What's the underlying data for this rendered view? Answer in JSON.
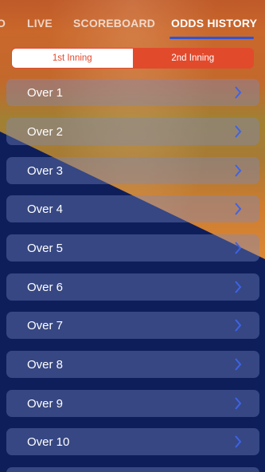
{
  "tabs": [
    {
      "label": "O",
      "active": false
    },
    {
      "label": "LIVE",
      "active": false
    },
    {
      "label": "SCOREBOARD",
      "active": false
    },
    {
      "label": "ODDS HISTORY",
      "active": true
    }
  ],
  "innings": {
    "options": [
      "1st Inning",
      "2nd Inning"
    ],
    "selected": "1st Inning"
  },
  "overs": [
    {
      "label": "Over 1"
    },
    {
      "label": "Over 2"
    },
    {
      "label": "Over 3"
    },
    {
      "label": "Over 4"
    },
    {
      "label": "Over 5"
    },
    {
      "label": "Over 6"
    },
    {
      "label": "Over 7"
    },
    {
      "label": "Over 8"
    },
    {
      "label": "Over 9"
    },
    {
      "label": "Over 10"
    }
  ],
  "colors": {
    "accent": "#e24a2c",
    "tab_indicator": "#2f55d4",
    "chevron": "#3d63e6",
    "background": "#0e1e5a"
  },
  "icons": {
    "row_action": "chevron-right-icon"
  }
}
